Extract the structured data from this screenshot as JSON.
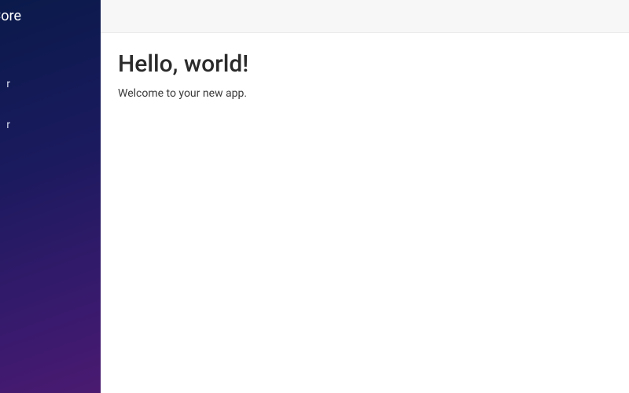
{
  "brand": {
    "title": "ms Core"
  },
  "sidebar": {
    "items": [
      {
        "label": "r"
      },
      {
        "label": "r"
      }
    ]
  },
  "main": {
    "heading": "Hello, world!",
    "subtext": "Welcome to your new app."
  }
}
